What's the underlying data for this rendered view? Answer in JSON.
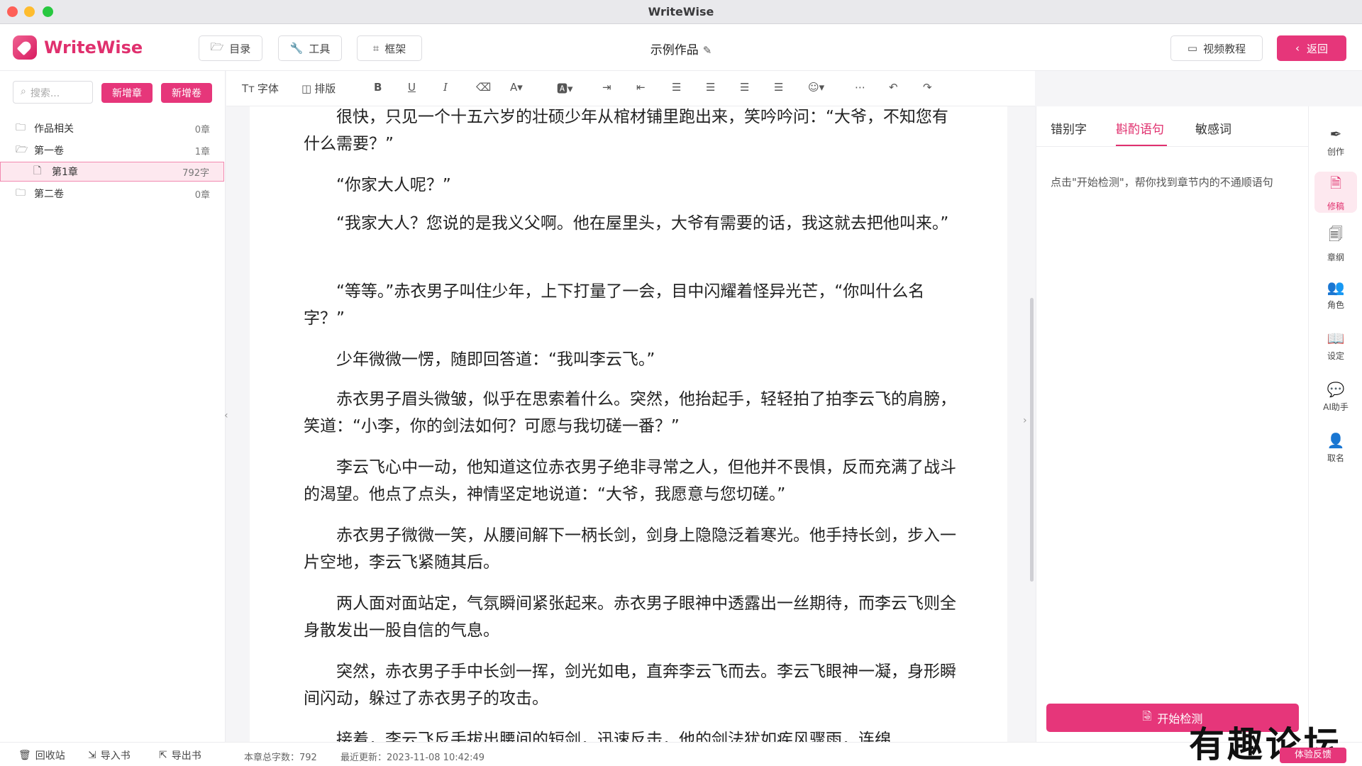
{
  "window": {
    "title": "WriteWise"
  },
  "header": {
    "logo_text": "WriteWise",
    "toc_label": "目录",
    "tools_label": "工具",
    "frame_label": "框架",
    "work_title": "示例作品",
    "video_label": "视频教程",
    "back_label": "返回"
  },
  "sidebar": {
    "search_placeholder": "搜索...",
    "new_chapter": "新增章",
    "new_volume": "新增卷",
    "tree": [
      {
        "label": "作品相关",
        "count": "0章"
      },
      {
        "label": "第一卷",
        "count": "1章"
      },
      {
        "label": "第1章",
        "count": "792字"
      },
      {
        "label": "第二卷",
        "count": "0章"
      }
    ]
  },
  "bottom": {
    "recycle": "回收站",
    "import": "导入书",
    "export": "导出书",
    "word_count": "本章总字数：792",
    "last_update": "最近更新：2023-11-08 10:42:49"
  },
  "toolbar": {
    "font_label": "字体",
    "layout_label": "排版"
  },
  "editor": {
    "paragraphs": [
      "很快，只见一个十五六岁的壮硕少年从棺材铺里跑出来，笑吟吟问：“大爷，不知您有什么需要？”",
      "“你家大人呢？”",
      "“我家大人？您说的是我义父啊。他在屋里头，大爷有需要的话，我这就去把他叫来。”",
      "“等等。”赤衣男子叫住少年，上下打量了一会，目中闪耀着怪异光芒，“你叫什么名字？”",
      "少年微微一愣，随即回答道：“我叫李云飞。”",
      "赤衣男子眉头微皱，似乎在思索着什么。突然，他抬起手，轻轻拍了拍李云飞的肩膀，笑道：“小李，你的剑法如何？可愿与我切磋一番？”",
      "李云飞心中一动，他知道这位赤衣男子绝非寻常之人，但他并不畏惧，反而充满了战斗的渴望。他点了点头，神情坚定地说道：“大爷，我愿意与您切磋。”",
      "赤衣男子微微一笑，从腰间解下一柄长剑，剑身上隐隐泛着寒光。他手持长剑，步入一片空地，李云飞紧随其后。",
      "两人面对面站定，气氛瞬间紧张起来。赤衣男子眼神中透露出一丝期待，而李云飞则全身散发出一股自信的气息。",
      "突然，赤衣男子手中长剑一挥，剑光如电，直奔李云飞而去。李云飞眼神一凝，身形瞬间闪动，躲过了赤衣男子的攻击。",
      "接着，李云飞反手拔出腰间的短剑，迅速反击，他的剑法犹如疾风骤雨，连绵"
    ]
  },
  "right_panel": {
    "tabs": [
      "错别字",
      "斟酌语句",
      "敏感词"
    ],
    "hint": "点击\"开始检测\"，帮你找到章节内的不通顺语句",
    "start_button": "开始检测"
  },
  "rail": [
    {
      "label": "创作",
      "icon": "pen-icon"
    },
    {
      "label": "修稿",
      "icon": "edit-doc-icon"
    },
    {
      "label": "章纲",
      "icon": "outline-icon"
    },
    {
      "label": "角色",
      "icon": "people-icon"
    },
    {
      "label": "设定",
      "icon": "book-icon"
    },
    {
      "label": "AI助手",
      "icon": "chat-icon"
    },
    {
      "label": "取名",
      "icon": "person-add-icon"
    }
  ],
  "overlay": {
    "watermark": "有趣论坛",
    "feedback": "体验反馈"
  },
  "colors": {
    "accent": "#e6367a",
    "active_bg": "#fde8ef"
  }
}
